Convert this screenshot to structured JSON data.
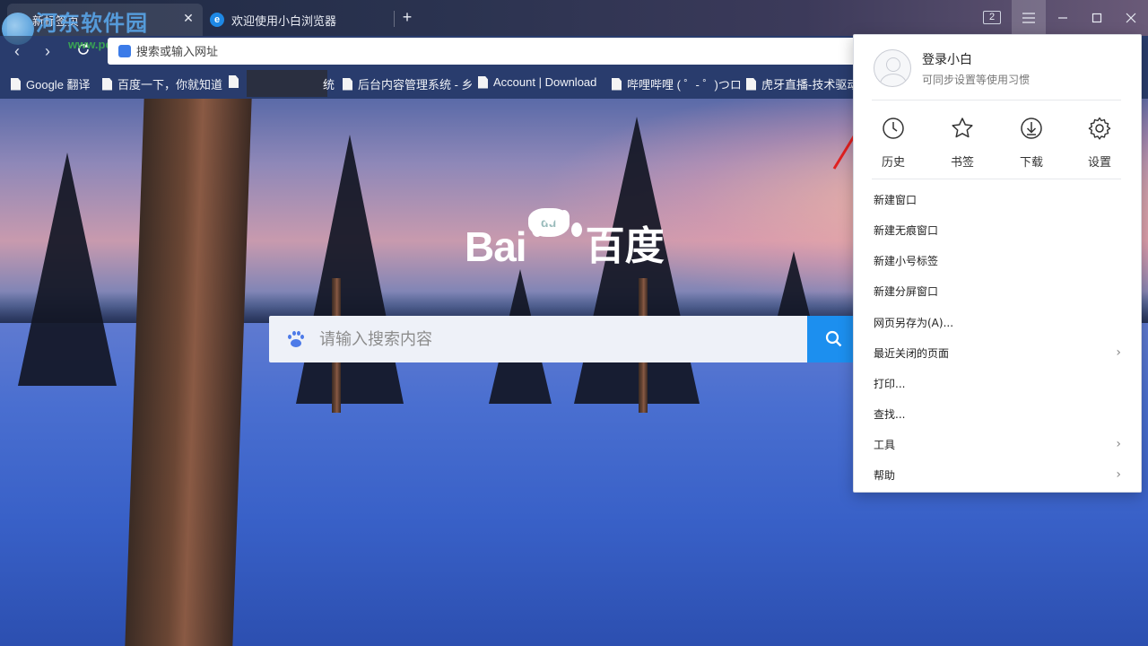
{
  "tabs": [
    {
      "label": "新标签页",
      "active": true
    },
    {
      "label": "欢迎使用小白浏览器",
      "active": false
    }
  ],
  "watermark": {
    "title": "河东软件园",
    "url": "www.pc0359.cn"
  },
  "window": {
    "tab_count": "2"
  },
  "address_bar": {
    "placeholder": "搜索或输入网址"
  },
  "bookmarks": [
    {
      "label": "Google 翻译"
    },
    {
      "label": "百度一下，你就知道"
    },
    {
      "label": "统"
    },
    {
      "label": "后台内容管理系统 - 乡"
    },
    {
      "label": "Account | Download"
    },
    {
      "label": "哔哩哔哩 ( ゜- ゜)つロ"
    },
    {
      "label": "虎牙直播-技术驱动"
    }
  ],
  "baidu": {
    "logo_latin": "Bai",
    "logo_cn": "百度",
    "search_placeholder": "请输入搜索内容"
  },
  "menu": {
    "user": {
      "name": "登录小白",
      "subtitle": "可同步设置等使用习惯"
    },
    "quick_actions": [
      {
        "label": "历史",
        "icon": "clock-icon"
      },
      {
        "label": "书签",
        "icon": "star-icon"
      },
      {
        "label": "下载",
        "icon": "download-icon"
      },
      {
        "label": "设置",
        "icon": "gear-icon"
      }
    ],
    "items": [
      {
        "label": "新建窗口",
        "submenu": false
      },
      {
        "label": "新建无痕窗口",
        "submenu": false
      },
      {
        "label": "新建小号标签",
        "submenu": false
      },
      {
        "label": "新建分屏窗口",
        "submenu": false
      },
      {
        "label": "网页另存为(A)...",
        "submenu": false
      },
      {
        "label": "最近关闭的页面",
        "submenu": true
      },
      {
        "label": "打印...",
        "submenu": false
      },
      {
        "label": "查找...",
        "submenu": false
      },
      {
        "label": "工具",
        "submenu": true
      },
      {
        "label": "帮助",
        "submenu": true
      }
    ]
  },
  "colors": {
    "accent": "#1c8fef",
    "annotation": "#e02020"
  }
}
